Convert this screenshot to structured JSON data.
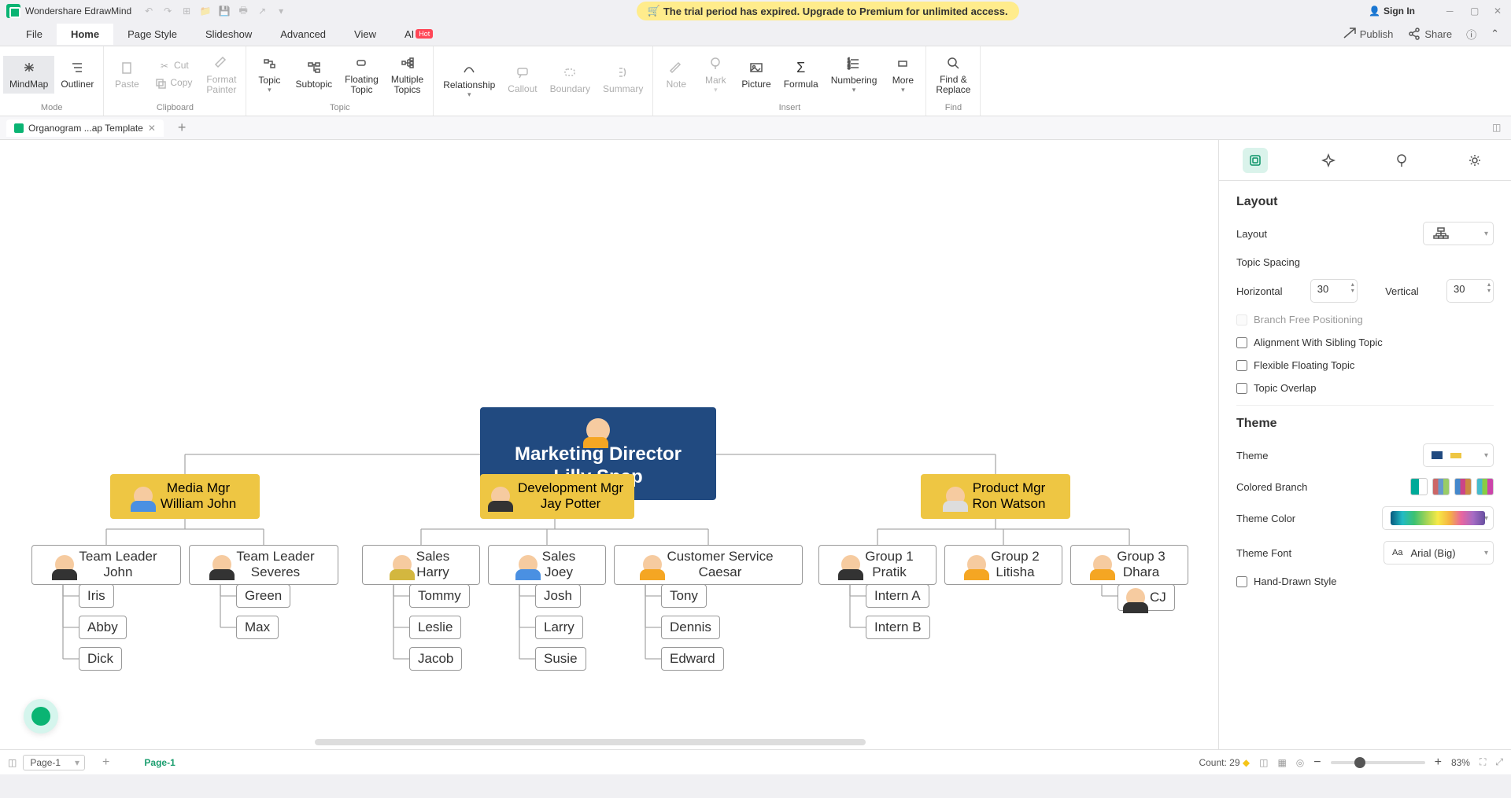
{
  "app_title": "Wondershare EdrawMind",
  "trial_banner": "The trial period has expired. Upgrade to Premium for unlimited access.",
  "signin": "Sign In",
  "tabs": [
    "File",
    "Home",
    "Page Style",
    "Slideshow",
    "Advanced",
    "View"
  ],
  "active_tab": "Home",
  "ai_label": "AI",
  "hot_label": "Hot",
  "header_right": {
    "publish": "Publish",
    "share": "Share"
  },
  "ribbon": {
    "mode": {
      "mindmap": "MindMap",
      "outliner": "Outliner",
      "label": "Mode"
    },
    "clipboard": {
      "paste": "Paste",
      "cut": "Cut",
      "copy": "Copy",
      "fp": "Format\nPainter",
      "label": "Clipboard"
    },
    "topic": {
      "topic": "Topic",
      "subtopic": "Subtopic",
      "floating": "Floating\nTopic",
      "multi": "Multiple\nTopics",
      "label": "Topic"
    },
    "rel": "Relationship",
    "callout": "Callout",
    "boundary": "Boundary",
    "summary": "Summary",
    "insert": {
      "note": "Note",
      "mark": "Mark",
      "picture": "Picture",
      "formula": "Formula",
      "numbering": "Numbering",
      "more": "More",
      "label": "Insert"
    },
    "find": {
      "btn": "Find &\nReplace",
      "label": "Find"
    }
  },
  "doctab": "Organogram ...ap Template",
  "side": {
    "layout_title": "Layout",
    "layout_label": "Layout",
    "spacing_title": "Topic Spacing",
    "horiz": "Horizontal",
    "vert": "Vertical",
    "horiz_val": "30",
    "vert_val": "30",
    "branch_free": "Branch Free Positioning",
    "align_sibling": "Alignment With Sibling Topic",
    "flex_float": "Flexible Floating Topic",
    "overlap": "Topic Overlap",
    "theme_title": "Theme",
    "theme_label": "Theme",
    "colored_branch": "Colored Branch",
    "theme_color": "Theme Color",
    "theme_font": "Theme Font",
    "theme_font_val": "Arial (Big)",
    "hand_drawn": "Hand-Drawn Style"
  },
  "status": {
    "page": "Page-1",
    "page_name": "Page-1",
    "count_label": "Count:",
    "count": "29",
    "zoom": "83%"
  },
  "chart_data": {
    "type": "org-chart",
    "root": {
      "title": "Marketing Director",
      "name": "Lilly Snap"
    },
    "branches": [
      {
        "mgr": {
          "role": "Media Mgr",
          "name": "William John"
        },
        "leads": [
          {
            "role": "Team Leader",
            "name": "John",
            "members": [
              "Iris",
              "Abby",
              "Dick"
            ]
          },
          {
            "role": "Team Leader",
            "name": "Severes",
            "members": [
              "Green",
              "Max"
            ]
          }
        ]
      },
      {
        "mgr": {
          "role": "Development Mgr",
          "name": "Jay Potter"
        },
        "leads": [
          {
            "role": "Sales",
            "name": "Harry",
            "members": [
              "Tommy",
              "Leslie",
              "Jacob"
            ]
          },
          {
            "role": "Sales",
            "name": "Joey",
            "members": [
              "Josh",
              "Larry",
              "Susie"
            ]
          },
          {
            "role": "Customer Service",
            "name": "Caesar",
            "members": [
              "Tony",
              "Dennis",
              "Edward"
            ]
          }
        ]
      },
      {
        "mgr": {
          "role": "Product Mgr",
          "name": "Ron Watson"
        },
        "leads": [
          {
            "role": "Group 1",
            "name": "Pratik",
            "members": [
              "Intern A",
              "Intern B"
            ]
          },
          {
            "role": "Group 2",
            "name": "Litisha",
            "members": []
          },
          {
            "role": "Group 3",
            "name": "Dhara",
            "members": [
              "CJ"
            ]
          }
        ]
      }
    ]
  }
}
